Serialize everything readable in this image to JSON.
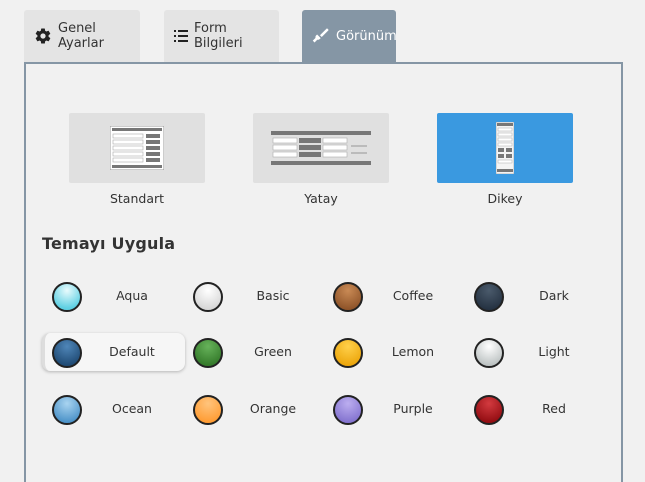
{
  "tabs": [
    {
      "label": "Genel Ayarlar",
      "icon": "gear-icon"
    },
    {
      "label": "Form Bilgileri",
      "icon": "list-icon"
    },
    {
      "label": "Görünüm",
      "icon": "brush-icon",
      "active": true
    }
  ],
  "layouts": [
    {
      "label": "Standart"
    },
    {
      "label": "Yatay"
    },
    {
      "label": "Dikey",
      "selected": true
    }
  ],
  "theme_section": {
    "title": "Temayı Uygula"
  },
  "themes": [
    {
      "name": "Aqua",
      "color": "#5fd0e3"
    },
    {
      "name": "Basic",
      "color": "#e6e6e6"
    },
    {
      "name": "Coffee",
      "color": "#a8683a"
    },
    {
      "name": "Dark",
      "color": "#2c3a4a"
    },
    {
      "name": "Default",
      "color": "#2a5a88",
      "selected": true
    },
    {
      "name": "Green",
      "color": "#3f8e33"
    },
    {
      "name": "Lemon",
      "color": "#f2b316"
    },
    {
      "name": "Light",
      "color": "#c9cdcd"
    },
    {
      "name": "Ocean",
      "color": "#5aa1d4"
    },
    {
      "name": "Orange",
      "color": "#ffa94a"
    },
    {
      "name": "Purple",
      "color": "#9583d6"
    },
    {
      "name": "Red",
      "color": "#a81319"
    }
  ],
  "colors": {
    "tab_active": "#8596a5",
    "layout_selected": "#3a99e0"
  }
}
